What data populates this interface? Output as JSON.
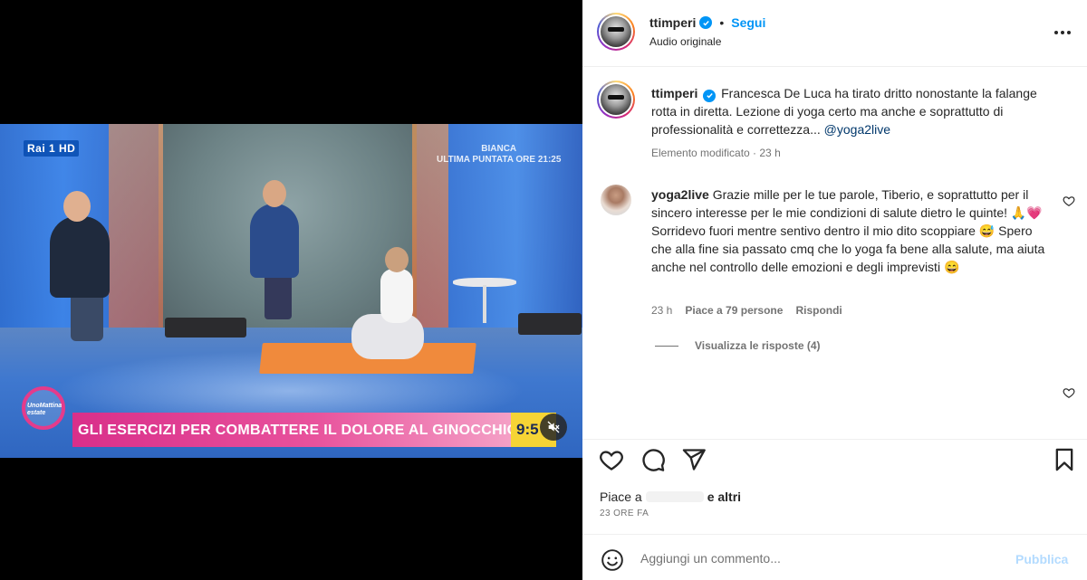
{
  "video": {
    "channel_logo": "Rai 1 HD",
    "promo_text": "BIANCA\nULTIMA PUNTATA ORE 21:25",
    "show_logo": "UnoMattina estate",
    "lower_third": "GLI ESERCIZI PER COMBATTERE IL DOLORE AL GINOCCHIO",
    "clock": "9:5",
    "mute_icon": "speaker-muted-icon"
  },
  "header": {
    "username": "ttimperi",
    "follow_label": "Segui",
    "separator": "•",
    "audio": "Audio originale",
    "more_icon": "more-horizontal-icon"
  },
  "caption": {
    "username": "ttimperi",
    "text": "Francesca De Luca ha tirato dritto nonostante la falange rotta in diretta. Lezione di yoga certo ma anche e soprattutto di professionalità e correttezza...",
    "mention": "@yoga2live",
    "meta": "Elemento modificato · 23 h"
  },
  "comment": {
    "username": "yoga2live",
    "text": "Grazie mille per le tue parole, Tiberio, e soprattutto per il sincero interesse per le mie condizioni di salute dietro le quinte! 🙏💗 Sorridevo fuori mentre sentivo dentro il mio dito scoppiare 😅 Spero che alla fine sia passato cmq che lo yoga fa bene alla salute, ma aiuta anche nel controllo delle emozioni e degli imprevisti 😄",
    "time": "23 h",
    "likes": "Piace a 79 persone",
    "reply": "Rispondi",
    "view_replies": "Visualizza le risposte (4)"
  },
  "actions": {
    "likes_prefix": "Piace a",
    "likes_suffix": "e altri",
    "timestamp": "23 ORE FA"
  },
  "add_comment": {
    "placeholder": "Aggiungi un commento...",
    "publish_label": "Pubblica"
  },
  "colors": {
    "accent": "#0095f6",
    "lower_third": "#e8529c",
    "clock_bg": "#f6d435"
  }
}
